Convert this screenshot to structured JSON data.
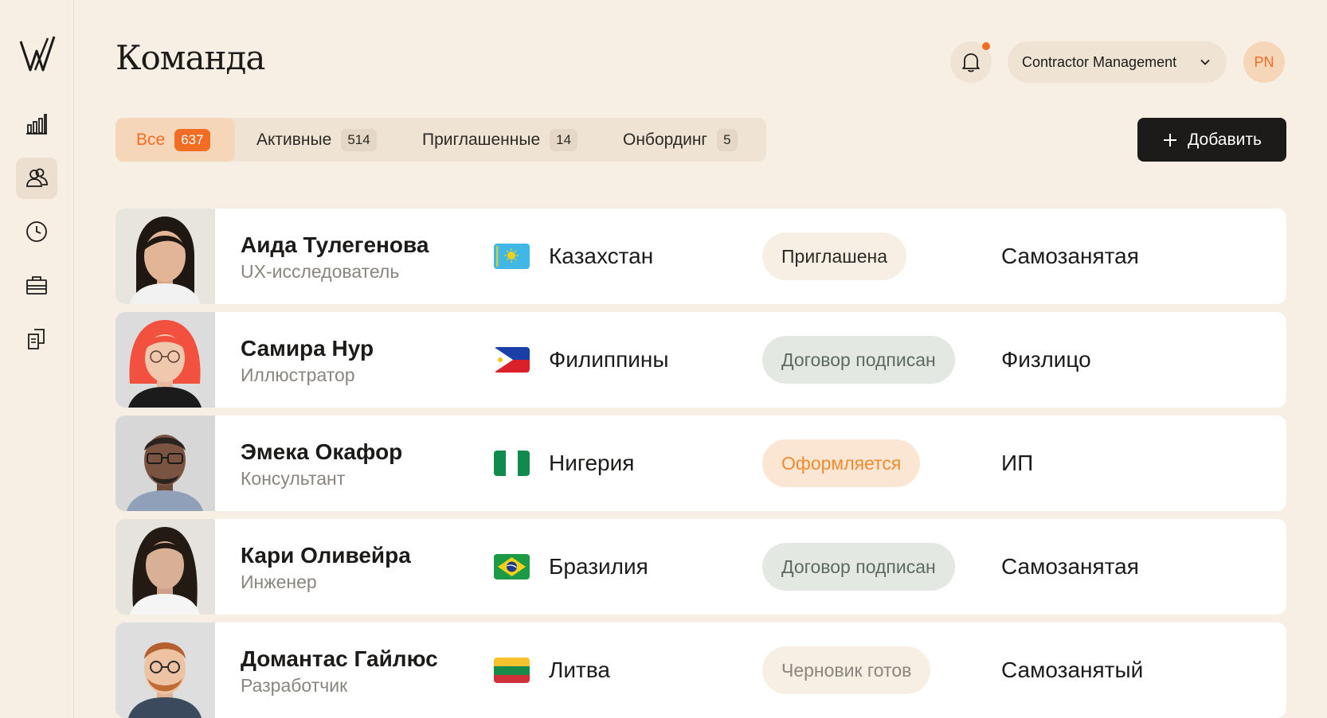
{
  "page": {
    "title": "Команда"
  },
  "header": {
    "workspace_label": "Contractor Management",
    "user_initials": "PN"
  },
  "tabs": [
    {
      "label": "Все",
      "count": "637"
    },
    {
      "label": "Активные",
      "count": "514"
    },
    {
      "label": "Приглашенные",
      "count": "14"
    },
    {
      "label": "Онбординг",
      "count": "5"
    }
  ],
  "actions": {
    "add_label": "Добавить"
  },
  "sidebar": {
    "items": [
      {
        "icon": "bar-chart-icon"
      },
      {
        "icon": "people-icon"
      },
      {
        "icon": "clock-icon"
      },
      {
        "icon": "briefcase-icon"
      },
      {
        "icon": "documents-icon"
      }
    ]
  },
  "members": [
    {
      "name": "Аида Тулегенова",
      "role": "UX-исследователь",
      "country": "Казахстан",
      "status": "Приглашена",
      "legal": "Самозанятая",
      "status_kind": "neutral"
    },
    {
      "name": "Самира Нур",
      "role": "Иллюстратор",
      "country": "Филиппины",
      "status": "Договор подписан",
      "legal": "Физлицо",
      "status_kind": "signed"
    },
    {
      "name": "Эмека Окафор",
      "role": "Консультант",
      "country": "Нигерия",
      "status": "Оформляется",
      "legal": "ИП",
      "status_kind": "processing"
    },
    {
      "name": "Кари Оливейра",
      "role": "Инженер",
      "country": "Бразилия",
      "status": "Договор подписан",
      "legal": "Самозанятая",
      "status_kind": "signed"
    },
    {
      "name": "Домантас Гайлюс",
      "role": "Разработчик",
      "country": "Литва",
      "status": "Черновик готов",
      "legal": "Самозанятый",
      "status_kind": "draft"
    }
  ],
  "colors": {
    "background": "#f7efe4",
    "accent": "#f06d23",
    "primary_button": "#1c1b19"
  }
}
